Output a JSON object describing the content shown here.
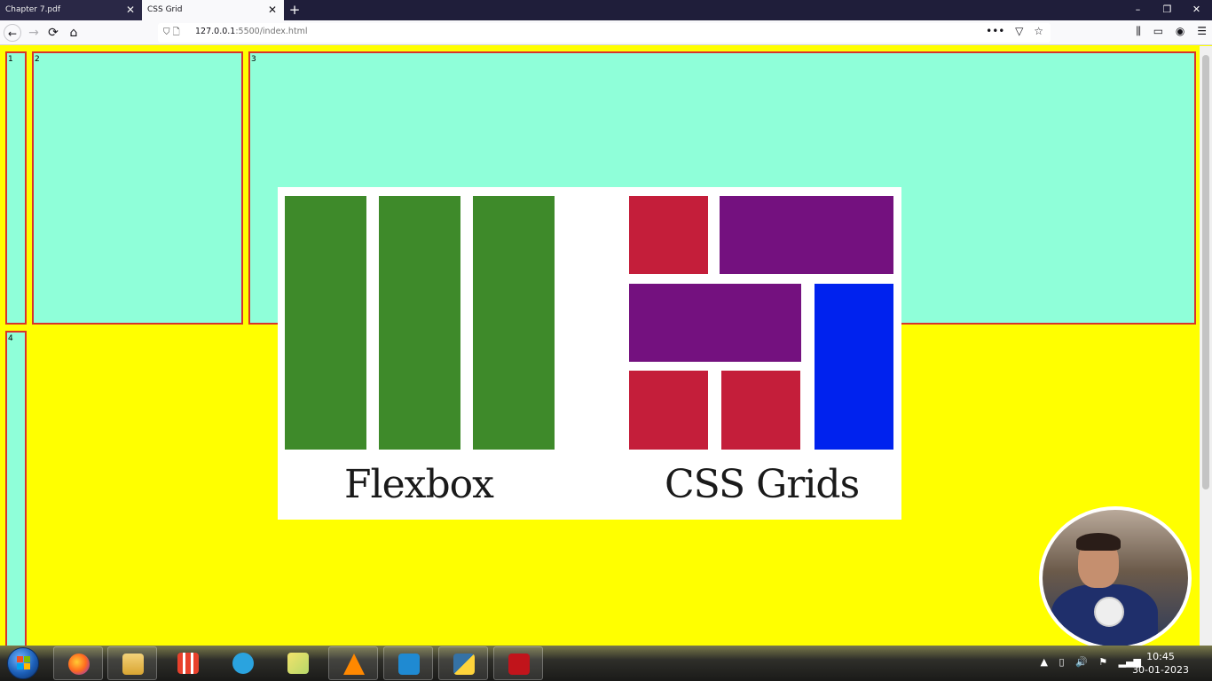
{
  "browser": {
    "tabs": [
      {
        "title": "Chapter 7.pdf",
        "active": false
      },
      {
        "title": "CSS Grid",
        "active": true
      }
    ],
    "new_tab_icon": "plus-icon",
    "window_controls": {
      "minimize": "–",
      "restore": "❐",
      "close": "✕"
    },
    "url": {
      "host": "127.0.0.1",
      "rest": ":5500/index.html"
    },
    "nav_icons": {
      "back": "←",
      "forward": "→",
      "reload": "⟳",
      "home": "⌂"
    },
    "url_actions": {
      "more": "•••",
      "pocket": "▽",
      "bookmark": "☆"
    },
    "toolbar_icons": {
      "library": "⫼",
      "sidebar": "▭",
      "account": "◉",
      "menu": "☰"
    }
  },
  "page": {
    "grid_items": [
      {
        "label": "1",
        "color": "#8fffd9"
      },
      {
        "label": "2",
        "color": "#8fffd9"
      },
      {
        "label": "3",
        "color": "#8fffd9"
      },
      {
        "label": "4",
        "color": "#8fffd9"
      }
    ],
    "background_color": "#ffff00",
    "item_border_color": "#d9342b"
  },
  "overlay": {
    "captions": {
      "left": "Flexbox",
      "right": "CSS Grids"
    },
    "colors": {
      "green": "#3e8a2a",
      "red": "#c41e3a",
      "purple": "#74117f",
      "blue": "#0022ee"
    }
  },
  "taskbar": {
    "apps": [
      "firefox",
      "file-explorer",
      "app-grid",
      "telegram",
      "sticky-notes",
      "vlc",
      "vscode",
      "python-idle",
      "acrobat"
    ],
    "clock": {
      "time": "10:45",
      "date": "30-01-2023"
    },
    "tray_icons": [
      "▲",
      "▯",
      "🔊",
      "⚑",
      "▂▄▆"
    ]
  }
}
